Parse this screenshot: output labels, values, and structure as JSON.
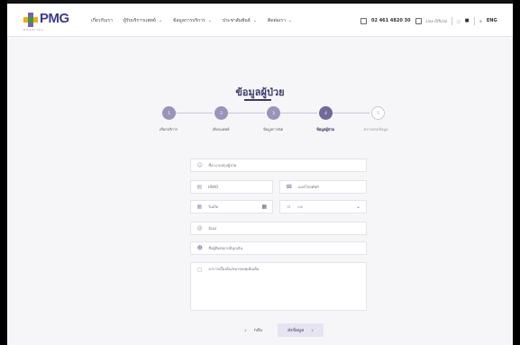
{
  "header": {
    "logo_text": "PMG",
    "logo_sub": "HOSPITAL",
    "nav": [
      {
        "label": "เกี่ยวกับเรา",
        "has_dropdown": false
      },
      {
        "label": "ผู้รับบริการแพทย์",
        "has_dropdown": true
      },
      {
        "label": "ข้อมูลการบริการ",
        "has_dropdown": true
      },
      {
        "label": "ประชาสัมพันธ์",
        "has_dropdown": true
      },
      {
        "label": "ติดต่อเรา",
        "has_dropdown": true
      }
    ],
    "phone": "02 461 4820 30",
    "line": "Line Official",
    "lang": "ENG",
    "chevron": "⌄"
  },
  "page_title": "ข้อมูลผู้ป่วย",
  "steps": [
    {
      "number": "1",
      "label": "เลือกบริการ",
      "state": "done"
    },
    {
      "number": "2",
      "label": "เลือกแพทย์",
      "state": "done"
    },
    {
      "number": "3",
      "label": "ข้อมูลการนัด",
      "state": "done"
    },
    {
      "number": "4",
      "label": "ข้อมูลผู้ป่วย",
      "state": "active"
    },
    {
      "number": "5",
      "label": "ตรวจสอบข้อมูล",
      "state": "pending"
    }
  ],
  "form": {
    "name_placeholder": "ชื่อ-นามสกุลผู้ป่วย",
    "id_placeholder": "HN/ID",
    "phone_placeholder": "เบอร์โทรศัพท์",
    "dob_placeholder": "วันเกิด",
    "gender_placeholder": "เพศ",
    "email_placeholder": "อีเมล",
    "contact_placeholder": "ชื่อผู้ติดต่อกรณีฉุกเฉิน",
    "note_placeholder": "อาการเบื้องต้น/หมายเหตุเพิ่มเติม"
  },
  "buttons": {
    "back_label": "กลับ",
    "next_label": "ส่งข้อมูล",
    "back_arrow": "‹",
    "next_arrow": "›"
  },
  "colors": {
    "brand": "#3b3a8e",
    "step_done": "#9a95b8",
    "step_active": "#6f6a9a"
  }
}
